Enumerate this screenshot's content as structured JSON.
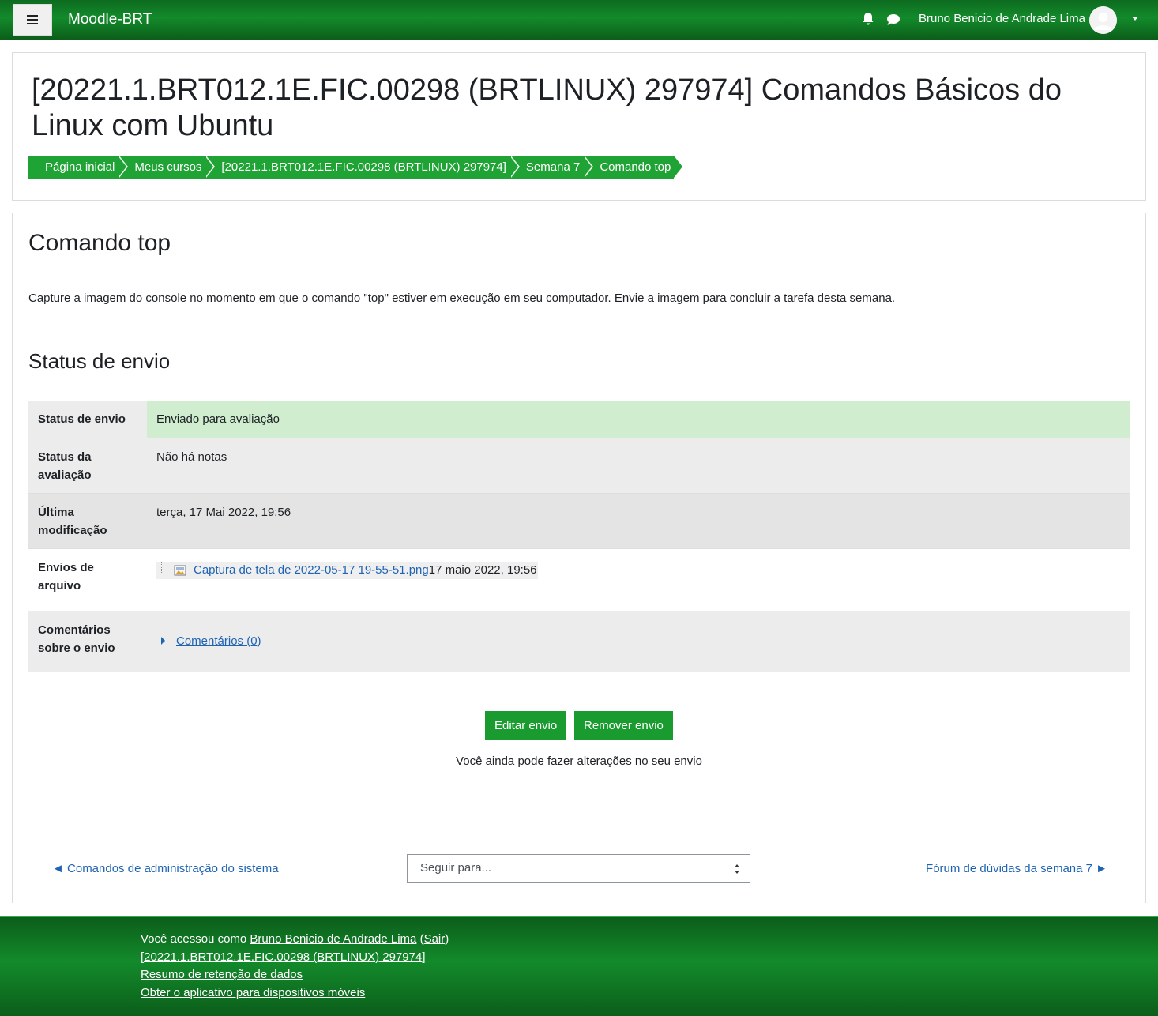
{
  "navbar": {
    "brand": "Moodle-BRT",
    "user_name": "Bruno Benicio de Andrade Lima"
  },
  "header": {
    "title": "[20221.1.BRT012.1E.FIC.00298 (BRTLINUX) 297974] Comandos Básicos do Linux com Ubuntu",
    "breadcrumb": [
      "Página inicial",
      "Meus cursos",
      "[20221.1.BRT012.1E.FIC.00298 (BRTLINUX) 297974]",
      "Semana 7",
      "Comando top"
    ]
  },
  "assignment": {
    "heading": "Comando top",
    "intro": "Capture a imagem do console no momento em que o comando \"top\" estiver em execução em seu computador. Envie a imagem para concluir a tarefa desta semana.",
    "status_heading": "Status de envio"
  },
  "status_table": [
    {
      "label": "Status de envio",
      "value": "Enviado para avaliação"
    },
    {
      "label": "Status da avaliação",
      "value": "Não há notas"
    },
    {
      "label": "Última modificação",
      "value": "terça, 17 Mai 2022, 19:56"
    },
    {
      "label": "Envios de arquivo",
      "file_name": "Captura de tela de 2022-05-17 19-55-51.png",
      "file_date": "17 maio 2022, 19:56"
    },
    {
      "label": "Comentários sobre o envio",
      "value": "Comentários (0)"
    }
  ],
  "actions": {
    "edit_label": "Editar envio",
    "remove_label": "Remover envio",
    "note": "Você ainda pode fazer alterações no seu envio"
  },
  "activity_nav": {
    "prev_label": "◄ Comandos de administração do sistema",
    "jump_placeholder": "Seguir para...",
    "next_label": "Fórum de dúvidas da semana 7 ►"
  },
  "footer": {
    "logged_in_prefix": "Você acessou como",
    "user_link": "Bruno Benicio de Andrade Lima",
    "logout_label": "Sair",
    "course_link": "[20221.1.BRT012.1E.FIC.00298 (BRTLINUX) 297974]",
    "data_retention": "Resumo de retenção de dados",
    "mobile_app": "Obter o aplicativo para dispositivos móveis"
  },
  "colors": {
    "navbar_green": "#138a2b",
    "breadcrumb_green": "#1fa334",
    "button_green": "#1a9b2f",
    "link_blue": "#1f64b3",
    "status_ok_bg": "#d0eecf"
  },
  "icons": [
    "menu-icon",
    "bell-icon",
    "chat-icon",
    "avatar",
    "caret-down-icon",
    "image-file-icon",
    "caret-right-icon",
    "select-arrows-icon"
  ]
}
